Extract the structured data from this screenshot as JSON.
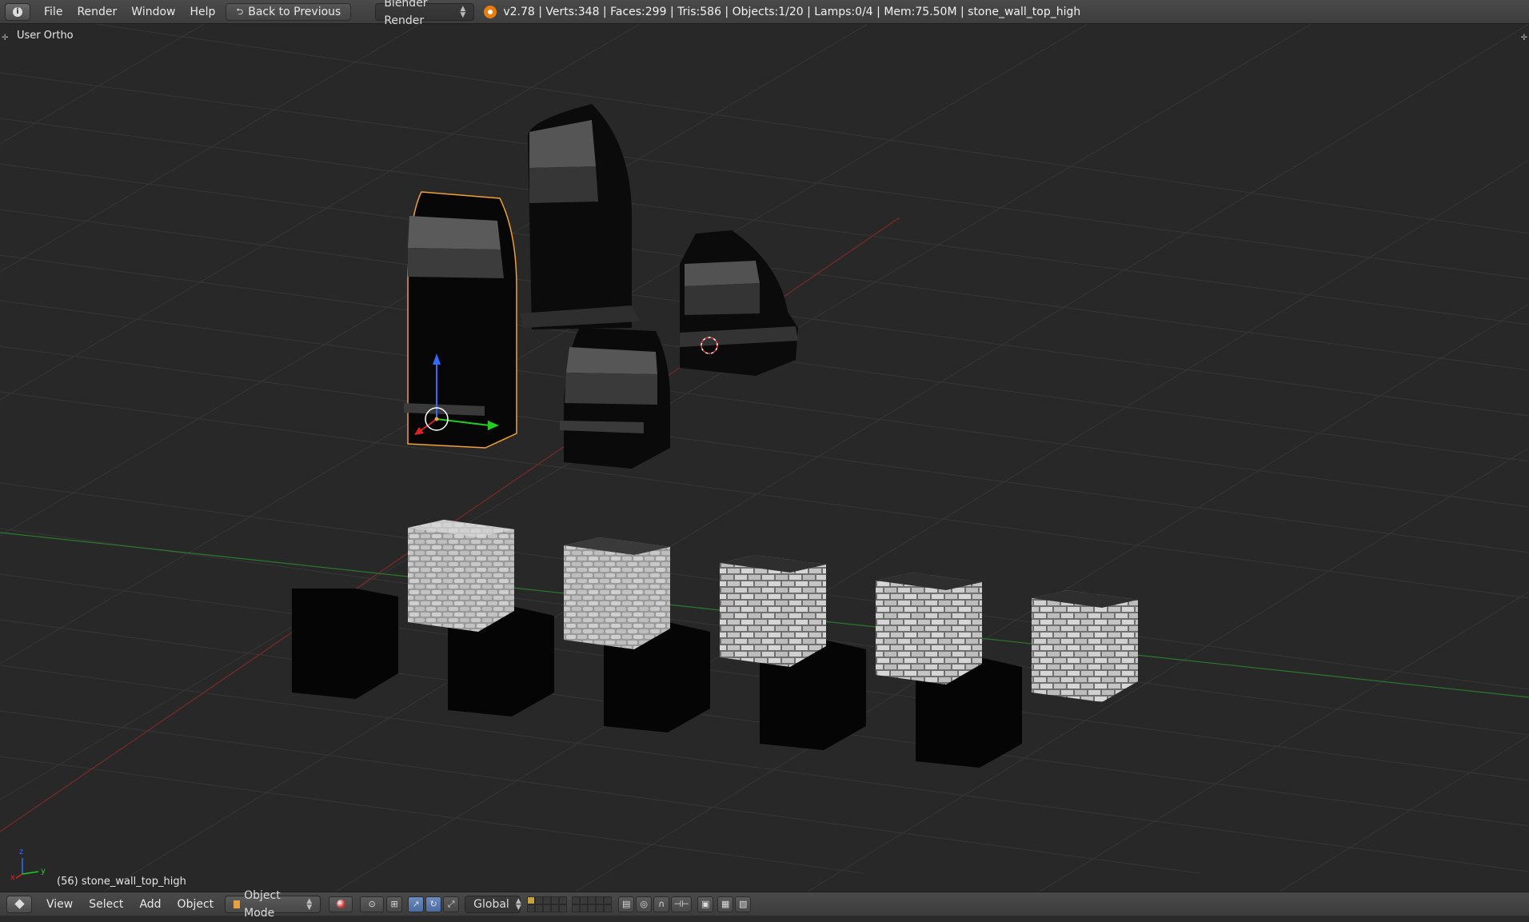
{
  "topbar": {
    "menus": [
      "File",
      "Render",
      "Window",
      "Help"
    ],
    "back_button": "Back to Previous",
    "render_engine": "Blender Render",
    "stats": "v2.78 | Verts:348 | Faces:299 | Tris:586 | Objects:1/20 | Lamps:0/4 | Mem:75.50M | stone_wall_top_high"
  },
  "viewport": {
    "view_label": "User Ortho",
    "object_label": "(56) stone_wall_top_high",
    "axis_x_label": "x",
    "axis_y_label": "y",
    "axis_z_label": "z"
  },
  "bottombar": {
    "menus": [
      "View",
      "Select",
      "Add",
      "Object"
    ],
    "mode": "Object Mode",
    "orientation": "Global"
  },
  "colors": {
    "selection_outline": "#f0a030",
    "grid_line": "#3a3a3a",
    "x_axis": "#8a2a2a",
    "y_axis": "#2a7a2a",
    "manip_z": "#2f6bff",
    "manip_y": "#22cc22",
    "manip_x": "#dd2222"
  }
}
